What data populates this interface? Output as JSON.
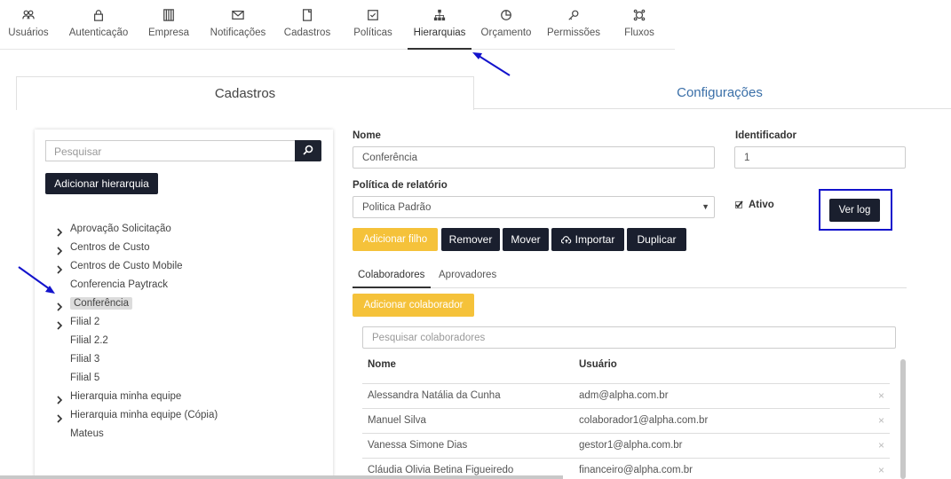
{
  "topnav": {
    "items": [
      {
        "label": "Usuários",
        "icon": "users-icon"
      },
      {
        "label": "Autenticação",
        "icon": "lock-icon"
      },
      {
        "label": "Empresa",
        "icon": "building-icon"
      },
      {
        "label": "Notificações",
        "icon": "envelope-icon"
      },
      {
        "label": "Cadastros",
        "icon": "clipboard-icon"
      },
      {
        "label": "Políticas",
        "icon": "checkbox-icon"
      },
      {
        "label": "Hierarquias",
        "icon": "hierarchy-icon",
        "active": true
      },
      {
        "label": "Orçamento",
        "icon": "pie-chart-icon"
      },
      {
        "label": "Permissões",
        "icon": "key-icon"
      },
      {
        "label": "Fluxos",
        "icon": "flow-icon"
      }
    ]
  },
  "main_tabs": [
    {
      "label": "Cadastros",
      "active": true
    },
    {
      "label": "Configurações",
      "active": false
    }
  ],
  "left": {
    "search_placeholder": "Pesquisar",
    "add_button": "Adicionar hierarquia",
    "tree": [
      {
        "label": "Aprovação Solicitação",
        "expandable": true
      },
      {
        "label": "Centros de Custo",
        "expandable": true
      },
      {
        "label": "Centros de Custo Mobile",
        "expandable": true
      },
      {
        "label": "Conferencia Paytrack",
        "expandable": false
      },
      {
        "label": "Conferência",
        "expandable": true,
        "selected": true
      },
      {
        "label": "Filial 2",
        "expandable": true
      },
      {
        "label": "Filial 2.2",
        "expandable": false
      },
      {
        "label": "Filial 3",
        "expandable": false
      },
      {
        "label": "Filial 5",
        "expandable": false
      },
      {
        "label": "Hierarquia minha equipe",
        "expandable": true
      },
      {
        "label": "Hierarquia minha equipe (Cópia)",
        "expandable": true
      },
      {
        "label": "Mateus",
        "expandable": false
      }
    ]
  },
  "form": {
    "nome_label": "Nome",
    "nome_value": "Conferência",
    "id_label": "Identificador",
    "id_value": "1",
    "politica_label": "Política de relatório",
    "politica_value": "Politica Padrão",
    "ativo_label": "Ativo",
    "ativo_checked": true,
    "verlog_button": "Ver log"
  },
  "actions": {
    "add_child": "Adicionar filho",
    "remove": "Remover",
    "move": "Mover",
    "import": "Importar",
    "duplicate": "Duplicar"
  },
  "subtabs": [
    {
      "label": "Colaboradores",
      "active": true
    },
    {
      "label": "Aprovadores",
      "active": false
    }
  ],
  "collaborators": {
    "add_button": "Adicionar colaborador",
    "search_placeholder": "Pesquisar colaboradores",
    "columns": [
      "Nome",
      "Usuário"
    ],
    "rows": [
      {
        "name": "Alessandra Natália da Cunha",
        "user": "adm@alpha.com.br"
      },
      {
        "name": "Manuel Silva",
        "user": "colaborador1@alpha.com.br"
      },
      {
        "name": "Vanessa Simone Dias",
        "user": "gestor1@alpha.com.br"
      },
      {
        "name": "Cláudia Olivia Betina Figueiredo",
        "user": "financeiro@alpha.com.br"
      }
    ],
    "remove_glyph": "×"
  },
  "colors": {
    "dark_button": "#1a1f2e",
    "yellow_button": "#f5c23a",
    "link_blue": "#3a6fa8",
    "annotation_blue": "#1313cc"
  }
}
